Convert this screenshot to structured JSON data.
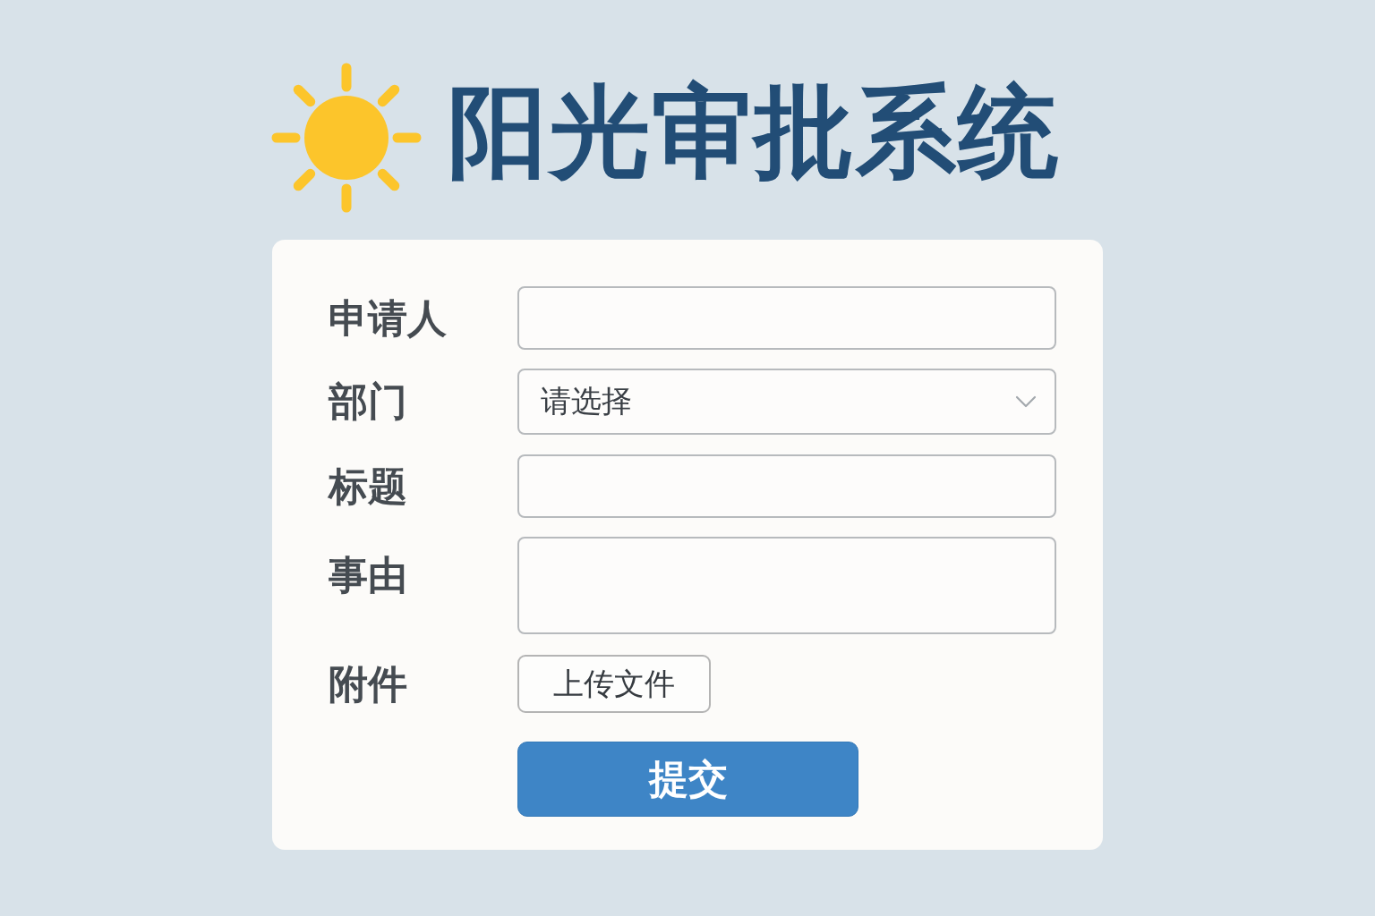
{
  "header": {
    "title": "阳光审批系统"
  },
  "form": {
    "fields": [
      {
        "kind": "text",
        "label": "申请人"
      },
      {
        "kind": "select",
        "label": "部门",
        "placeholder": "请选择"
      },
      {
        "kind": "text",
        "label": "标题"
      },
      {
        "kind": "textarea",
        "label": "事由"
      },
      {
        "kind": "file",
        "label": "附件",
        "button": "上传文件"
      }
    ],
    "submit": "提交"
  }
}
